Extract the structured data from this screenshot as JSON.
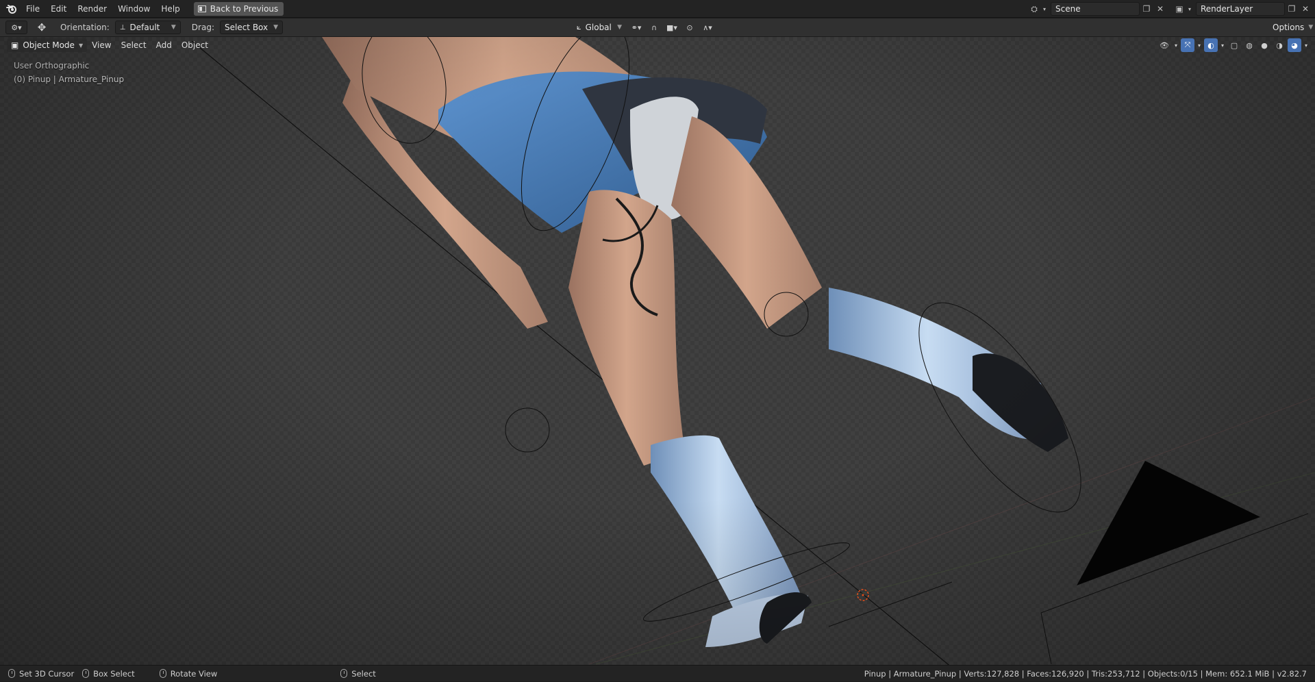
{
  "topbar": {
    "menus": [
      "File",
      "Edit",
      "Render",
      "Window",
      "Help"
    ],
    "back_button": "Back to Previous",
    "scene": "Scene",
    "render_layer": "RenderLayer"
  },
  "toolbar": {
    "orientation_label": "Orientation:",
    "orientation_value": "Default",
    "drag_label": "Drag:",
    "drag_value": "Select Box",
    "transform_orientation": "Global",
    "options": "Options"
  },
  "header": {
    "mode": "Object Mode",
    "menus": [
      "View",
      "Select",
      "Add",
      "Object"
    ]
  },
  "viewport": {
    "view_name": "User Orthographic",
    "object_info": "(0) Pinup | Armature_Pinup"
  },
  "statusbar": {
    "items": [
      "Set 3D Cursor",
      "Box Select",
      "Rotate View",
      "Select"
    ],
    "stats": "Pinup | Armature_Pinup | Verts:127,828 | Faces:126,920 | Tris:253,712 | Objects:0/15 | Mem: 652.1 MiB | v2.82.7"
  },
  "colors": {
    "accent": "#4772b3",
    "boots": "#9db8da",
    "dress": "#4f7fb8",
    "skin": "#c89a80"
  }
}
